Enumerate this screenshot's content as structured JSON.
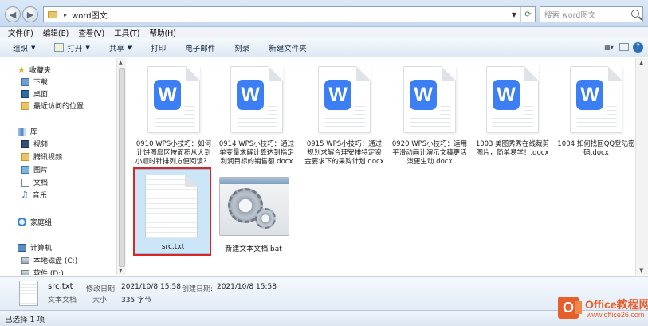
{
  "address_bar": {
    "path": "word图文",
    "separator": "▸",
    "search_placeholder": "搜索 word图文"
  },
  "menu": [
    "文件(F)",
    "编辑(E)",
    "查看(V)",
    "工具(T)",
    "帮助(H)"
  ],
  "toolbar": {
    "organize": "组织",
    "open": "打开",
    "share": "共享",
    "print": "打印",
    "email": "电子邮件",
    "burn": "刻录",
    "new_folder": "新建文件夹"
  },
  "nav": {
    "favorites": "收藏夹",
    "downloads": "下载",
    "desktop": "桌面",
    "recent": "最近访问的位置",
    "libraries": "库",
    "videos": "视频",
    "tencent_video": "腾讯视频",
    "pictures": "图片",
    "documents": "文档",
    "music": "音乐",
    "homegroup": "家庭组",
    "computer": "计算机",
    "local_disk": "本地磁盘 (C:)",
    "software": "软件 (D:)"
  },
  "files": [
    {
      "name": "0910 WPS小技巧：如何让饼图扇区按面积从大到小顺时针排列方便阅读？.docx",
      "badge": "W"
    },
    {
      "name": "0914  WPS小技巧：通过单变量求解计算达到指定利润目标的销售额.docx",
      "badge": "W"
    },
    {
      "name": "0915 WPS小技巧：通过规划求解合理安排特定资金要求下的采购计划.docx",
      "badge": "W"
    },
    {
      "name": "0920 WPS小技巧：运用平滑动画让演示文稿更活泼更生动.docx",
      "badge": "W"
    },
    {
      "name": "1003 美图秀秀在线裁剪图片，简单易学！.docx",
      "badge": "W"
    },
    {
      "name": "1004 如何找回QQ登陆密码.docx",
      "badge": "W"
    }
  ],
  "selected_file": {
    "name": "src.txt"
  },
  "bat_file": {
    "name": "新建文本文档.bat"
  },
  "details": {
    "name": "src.txt",
    "type": "文本文档",
    "modified_label": "修改日期:",
    "modified_value": "2021/10/8 15:58",
    "created_label": "创建日期:",
    "created_value": "2021/10/8 15:58",
    "size_label": "大小:",
    "size_value": "335 字节"
  },
  "status": "已选择 1 项",
  "watermark": {
    "logo_letter": "O",
    "title": "Office教程网",
    "url": "www.office26.com"
  },
  "colors": {
    "wps_blue": "#3c7ff5",
    "selection": "#cde6f7",
    "highlight_red": "#e02424",
    "watermark_orange": "#e65e2b"
  }
}
